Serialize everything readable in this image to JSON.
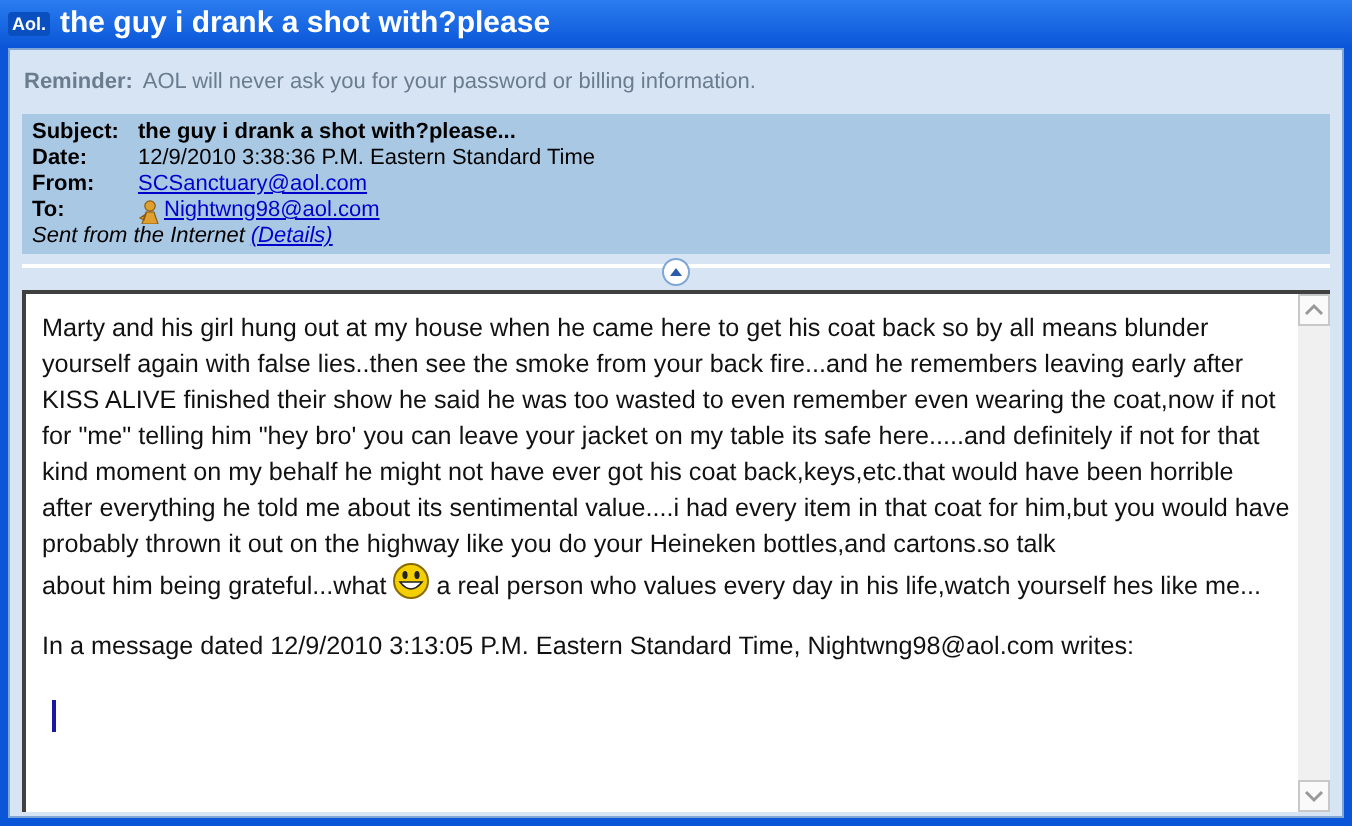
{
  "window": {
    "title": "the guy i drank a shot with?please",
    "logo": "Aol."
  },
  "reminder": {
    "label": "Reminder:",
    "text": "AOL will never ask you for your password or billing information."
  },
  "header": {
    "fields": [
      {
        "label": "Subject:",
        "value": "the guy i drank a shot with?please...",
        "kind": "bold"
      },
      {
        "label": "Date:",
        "value": "12/9/2010 3:38:36 P.M. Eastern Standard Time",
        "kind": "plain"
      },
      {
        "label": "From:",
        "value": "SCSanctuary@aol.com",
        "kind": "link"
      },
      {
        "label": "To:",
        "value": "Nightwng98@aol.com",
        "kind": "buddy-link"
      }
    ],
    "sent_note": "Sent from the Internet",
    "details_link": "(Details)"
  },
  "body": {
    "paragraph": "Marty and his girl hung out at my house when he came here to get his coat back so by all means blunder yourself again with false lies..then see the smoke from your back fire...and he remembers leaving early after KISS ALIVE finished their show he said he was too wasted to even remember even wearing the coat,now if not for \"me\" telling him \"hey bro' you can leave your jacket on my table its safe here.....and definitely if not for that kind moment on my behalf he might not have ever got his coat back,keys,etc.that would have been horrible after everything he told me about its sentimental value....i had every item in that coat for him,but you would have probably thrown it out on the highway like you do your Heineken bottles,and cartons.so talk",
    "text_before_emoticon": "about him being grateful...what",
    "text_after_emoticon": "a real person who values every day in his life,watch yourself hes like me...",
    "quote_line": "In a message dated 12/9/2010 3:13:05 P.M. Eastern Standard Time, Nightwng98@aol.com writes:"
  }
}
